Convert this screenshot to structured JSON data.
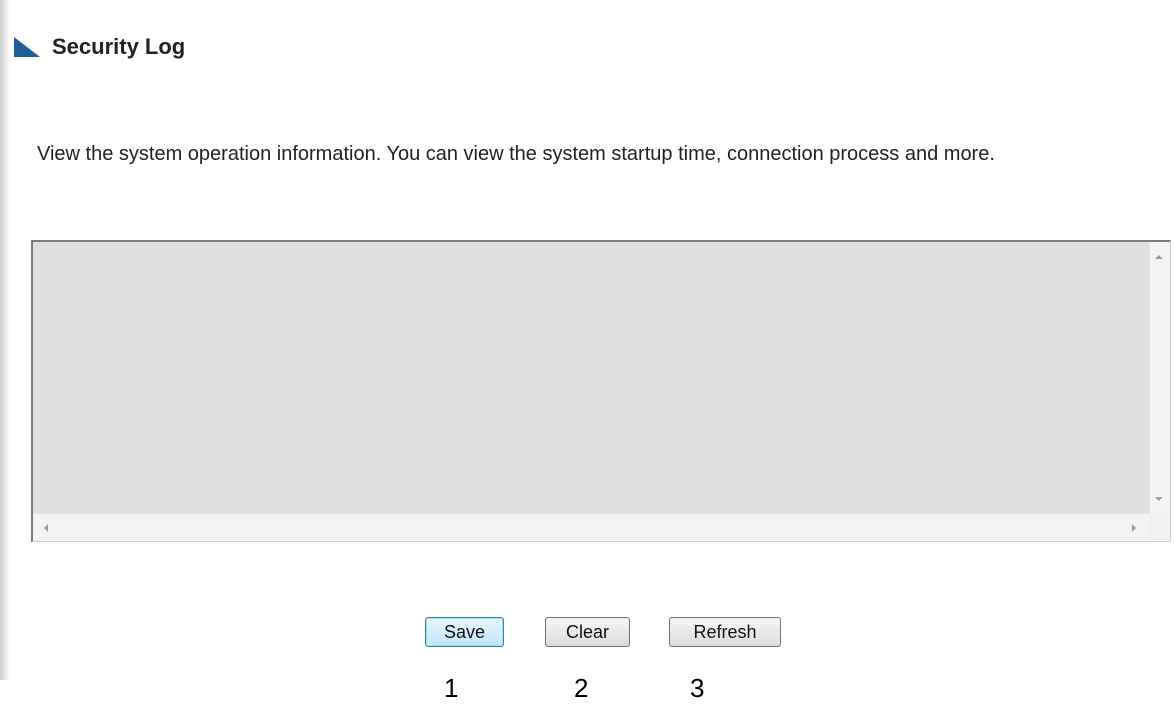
{
  "header": {
    "title": "Security Log",
    "icon": "triangle-corner-icon",
    "icon_color": "#1f5f99"
  },
  "description": "View the system operation information. You can view the system startup time, connection process and more.",
  "log": {
    "content": "",
    "background": "#e0e0e0"
  },
  "buttons": {
    "save_label": "Save",
    "clear_label": "Clear",
    "refresh_label": "Refresh"
  },
  "annotations": {
    "one": "1",
    "two": "2",
    "three": "3"
  }
}
